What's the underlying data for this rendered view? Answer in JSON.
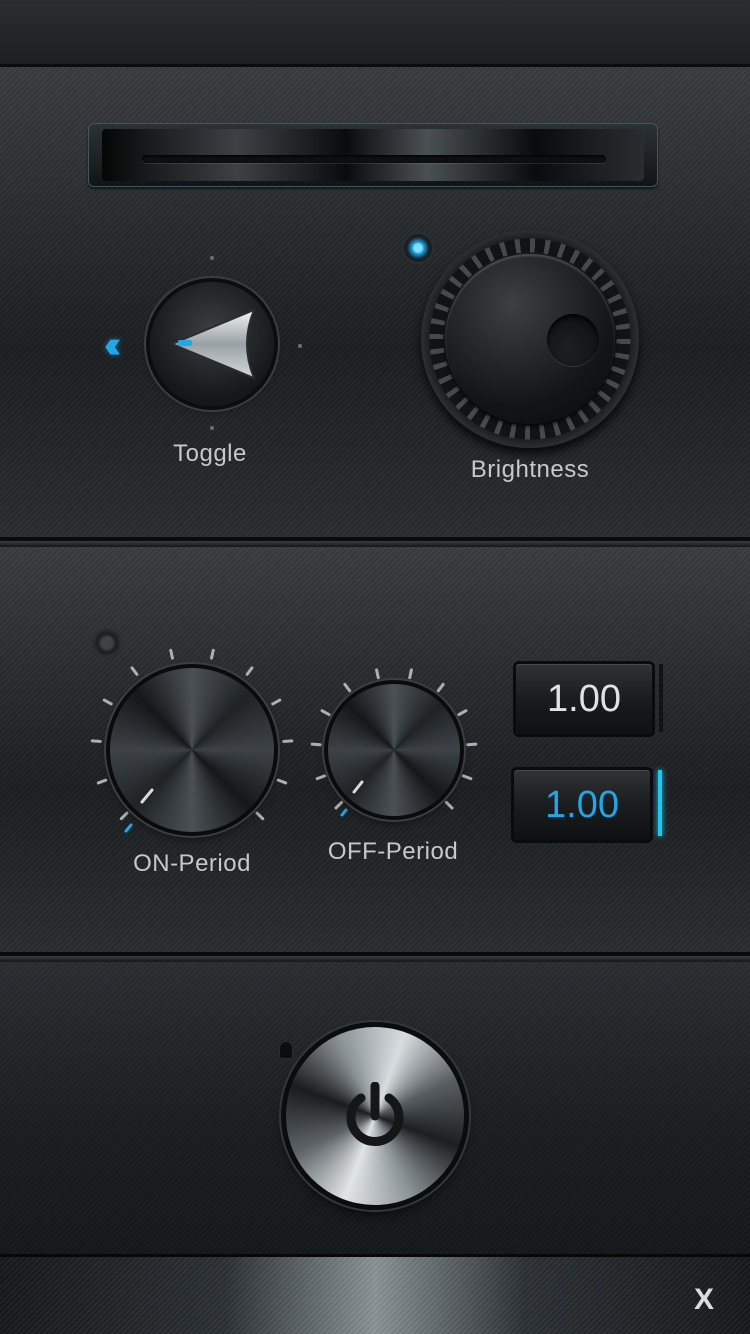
{
  "toggle": {
    "label": "Toggle",
    "direction_icon": "double-chevron-left-icon"
  },
  "brightness": {
    "label": "Brightness"
  },
  "on_period": {
    "label": "ON-Period",
    "value": "1.00"
  },
  "off_period": {
    "label": "OFF-Period",
    "value": "1.00"
  },
  "power": {
    "icon": "power-icon"
  },
  "footer": {
    "close_label": "X"
  },
  "colors": {
    "accent": "#21a6e8",
    "label": "#c4c9cc"
  }
}
